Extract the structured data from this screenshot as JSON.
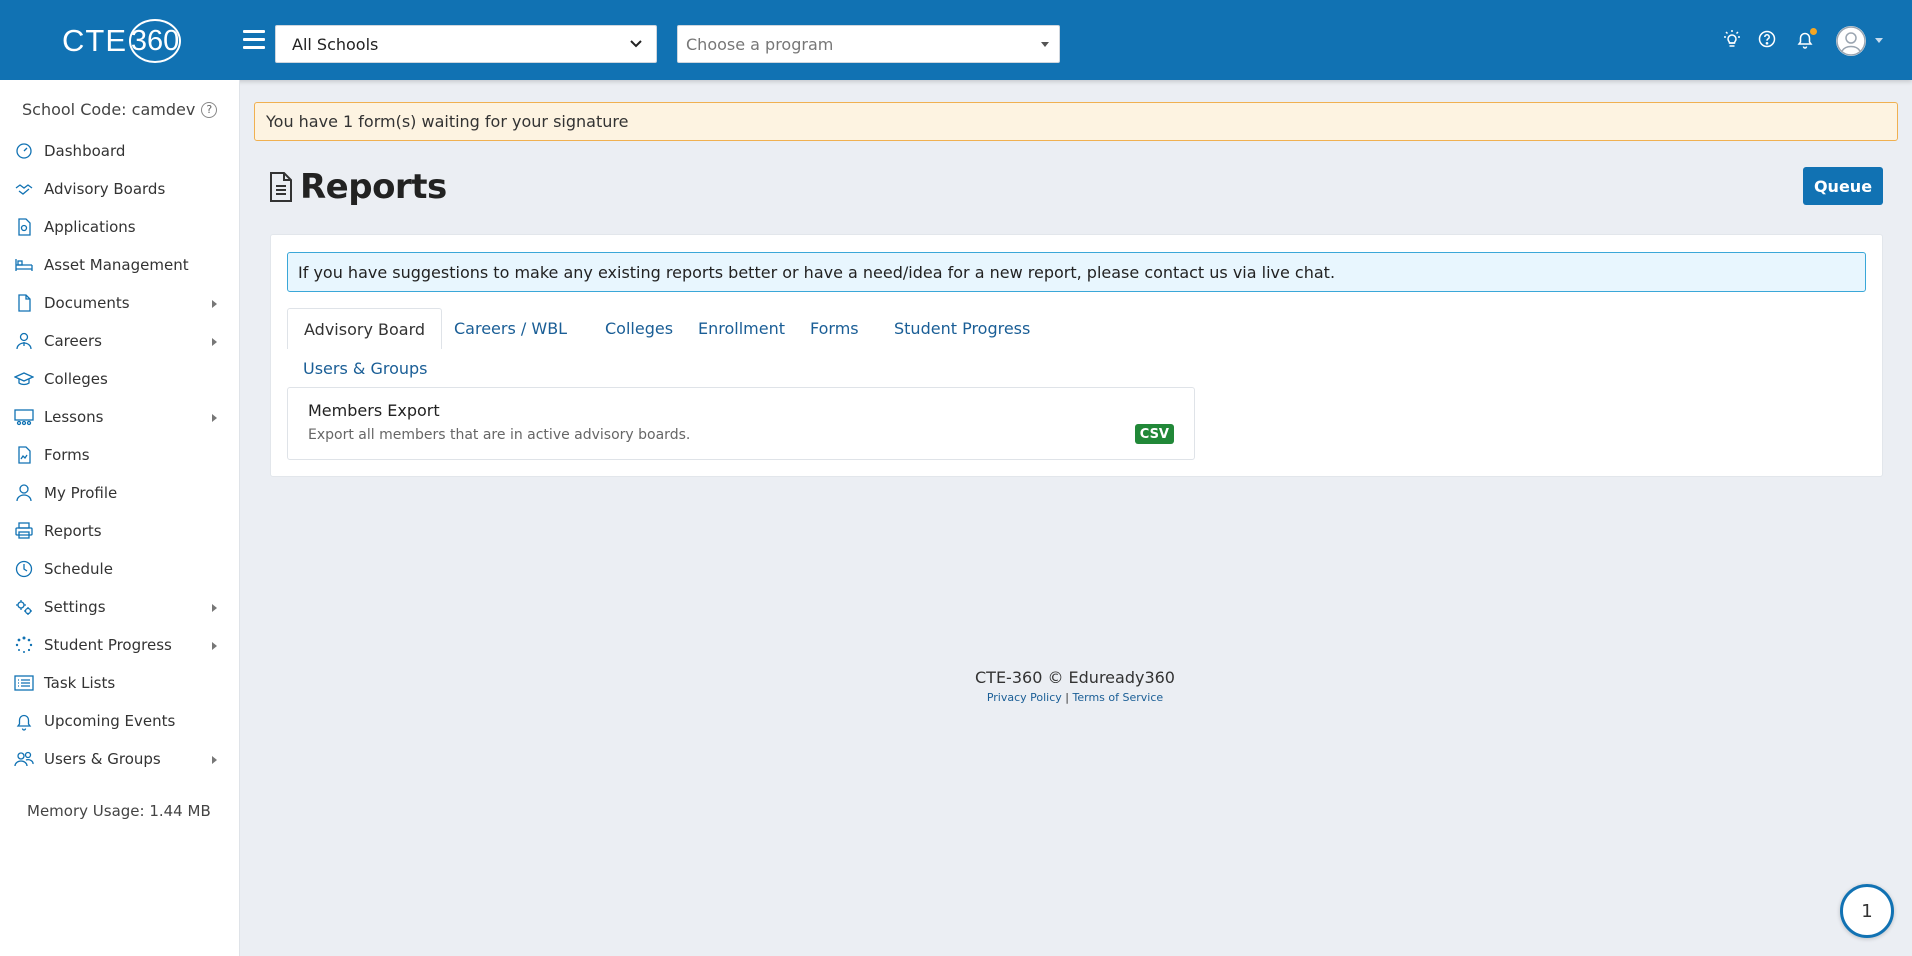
{
  "header": {
    "logo_text": "CTE",
    "logo_number": "360",
    "school_select": {
      "selected": "All Schools",
      "options": [
        "All Schools"
      ]
    },
    "program_select": {
      "placeholder": "Choose a program"
    }
  },
  "sidebar": {
    "school_code_label": "School Code: camdev",
    "items": [
      {
        "label": "Dashboard",
        "icon": "dashboard-icon",
        "has_submenu": false
      },
      {
        "label": "Advisory Boards",
        "icon": "handshake-icon",
        "has_submenu": false
      },
      {
        "label": "Applications",
        "icon": "application-icon",
        "has_submenu": false
      },
      {
        "label": "Asset Management",
        "icon": "asset-icon",
        "has_submenu": false
      },
      {
        "label": "Documents",
        "icon": "document-icon",
        "has_submenu": true
      },
      {
        "label": "Careers",
        "icon": "careers-icon",
        "has_submenu": true
      },
      {
        "label": "Colleges",
        "icon": "graduation-cap-icon",
        "has_submenu": false
      },
      {
        "label": "Lessons",
        "icon": "lessons-icon",
        "has_submenu": true
      },
      {
        "label": "Forms",
        "icon": "form-icon",
        "has_submenu": false
      },
      {
        "label": "My Profile",
        "icon": "user-icon",
        "has_submenu": false
      },
      {
        "label": "Reports",
        "icon": "printer-icon",
        "has_submenu": false
      },
      {
        "label": "Schedule",
        "icon": "clock-icon",
        "has_submenu": false
      },
      {
        "label": "Settings",
        "icon": "gears-icon",
        "has_submenu": true
      },
      {
        "label": "Student Progress",
        "icon": "spinner-icon",
        "has_submenu": true
      },
      {
        "label": "Task Lists",
        "icon": "list-icon",
        "has_submenu": false
      },
      {
        "label": "Upcoming Events",
        "icon": "bell-icon",
        "has_submenu": false
      },
      {
        "label": "Users & Groups",
        "icon": "users-icon",
        "has_submenu": true
      }
    ],
    "memory_usage": "Memory Usage: 1.44 MB"
  },
  "main": {
    "signature_alert": "You have 1 form(s) waiting for your signature",
    "page_title": "Reports",
    "queue_button": "Queue",
    "info_text": "If you have suggestions to make any existing reports better or have a need/idea for a new report, please contact us via live chat.",
    "tabs": [
      {
        "label": "Advisory Board",
        "active": true
      },
      {
        "label": "Careers / WBL",
        "active": false
      },
      {
        "label": "Colleges",
        "active": false
      },
      {
        "label": "Enrollment",
        "active": false
      },
      {
        "label": "Forms",
        "active": false
      },
      {
        "label": "Student Progress",
        "active": false
      },
      {
        "label": "Users & Groups",
        "active": false
      }
    ],
    "reports": [
      {
        "title": "Members Export",
        "description": "Export all members that are in active advisory boards.",
        "format": "CSV"
      }
    ]
  },
  "footer": {
    "copyright": "CTE-360 © Eduready360",
    "privacy": "Privacy Policy",
    "separator": "|",
    "terms": "Terms of Service"
  },
  "chat": {
    "count": "1"
  },
  "colors": {
    "brand": "#1172b3",
    "csv_badge": "#218838",
    "alert_border": "#f0b050",
    "info_border": "#3aa7d8"
  }
}
